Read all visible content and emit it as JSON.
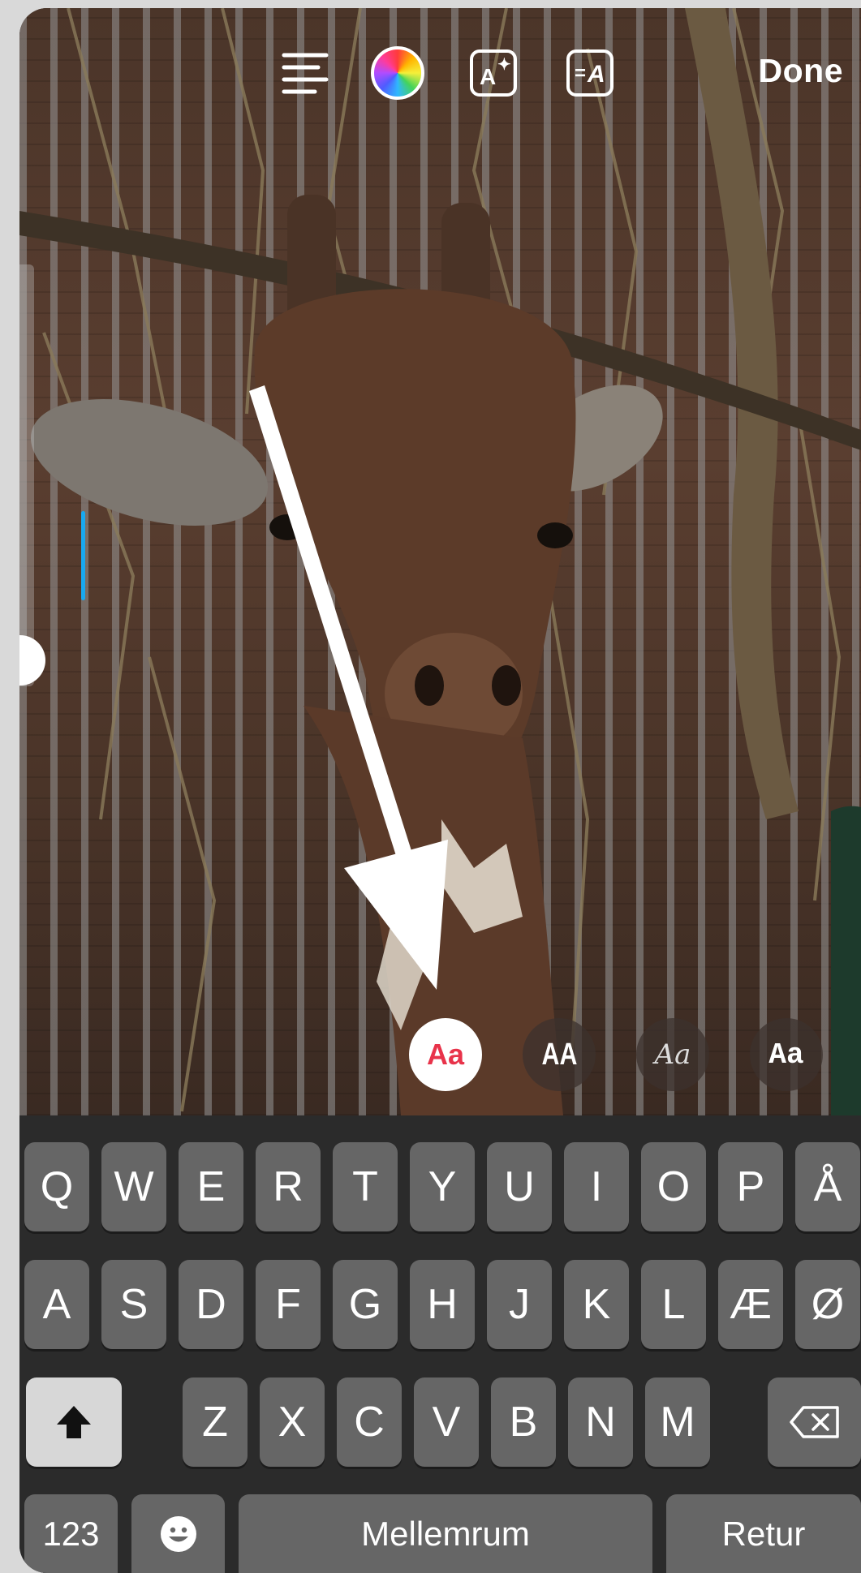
{
  "toolbar": {
    "align_icon": "text-align-left-icon",
    "color_icon": "color-wheel-icon",
    "effect_icon": "text-effect-sparkle-icon",
    "animate_icon": "text-animate-icon",
    "done_label": "Done"
  },
  "font_styles": [
    {
      "label": "Aa",
      "selected": true
    },
    {
      "label": "AA",
      "selected": false
    },
    {
      "label": "Aa",
      "selected": false
    },
    {
      "label": "Aa",
      "selected": false
    }
  ],
  "keyboard": {
    "row1": [
      "Q",
      "W",
      "E",
      "R",
      "T",
      "Y",
      "U",
      "I",
      "O",
      "P",
      "Å"
    ],
    "row2": [
      "A",
      "S",
      "D",
      "F",
      "G",
      "H",
      "J",
      "K",
      "L",
      "Æ",
      "Ø"
    ],
    "row3": [
      "Z",
      "X",
      "C",
      "V",
      "B",
      "N",
      "M"
    ],
    "shift_icon": "shift-arrow-icon",
    "backspace_icon": "backspace-icon",
    "numbers_label": "123",
    "emoji_icon": "emoji-icon",
    "space_label": "Mellemrum",
    "return_label": "Retur"
  },
  "colors": {
    "accent_cursor": "#18a9f0",
    "selected_font_text": "#e8334a",
    "key_bg": "#666666",
    "keyboard_bg": "#2b2b2b"
  }
}
